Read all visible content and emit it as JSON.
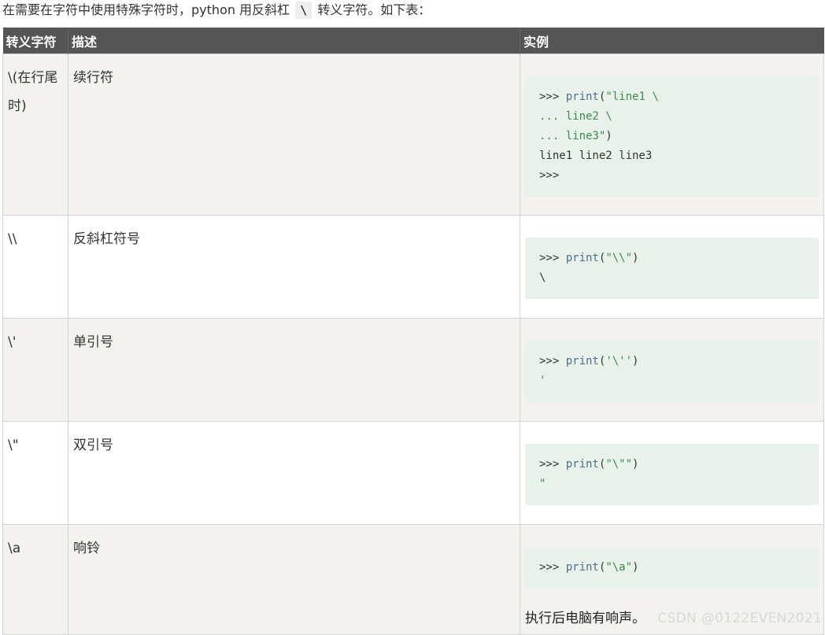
{
  "intro": {
    "text_before": "在需要在字符中使用特殊字符时，python 用反斜杠",
    "code": "\\",
    "text_after": "转义字符。如下表："
  },
  "table": {
    "headers": [
      "转义字符",
      "描述",
      "实例"
    ],
    "rows": [
      {
        "escape": "\\(在行尾时)",
        "description": "续行符",
        "code_lines": [
          [
            {
              "t": ">>> ",
              "c": "p"
            },
            {
              "t": "print",
              "c": "fn"
            },
            {
              "t": "(",
              "c": "p"
            },
            {
              "t": "\"line1 \\",
              "c": "s"
            }
          ],
          [
            {
              "t": "... ",
              "c": "s"
            },
            {
              "t": "line2 \\",
              "c": "s"
            }
          ],
          [
            {
              "t": "... ",
              "c": "s"
            },
            {
              "t": "line3\"",
              "c": "s"
            },
            {
              "t": ")",
              "c": "p"
            }
          ],
          [
            {
              "t": "line1 line2 line3",
              "c": "p"
            }
          ],
          [
            {
              "t": ">>>",
              "c": "p"
            }
          ]
        ],
        "note": ""
      },
      {
        "escape": "\\\\",
        "description": "反斜杠符号",
        "code_lines": [
          [
            {
              "t": ">>> ",
              "c": "p"
            },
            {
              "t": "print",
              "c": "fn"
            },
            {
              "t": "(",
              "c": "p"
            },
            {
              "t": "\"\\\\\"",
              "c": "s"
            },
            {
              "t": ")",
              "c": "p"
            }
          ],
          [
            {
              "t": "\\",
              "c": "p"
            }
          ]
        ],
        "note": ""
      },
      {
        "escape": "\\'",
        "description": "单引号",
        "code_lines": [
          [
            {
              "t": ">>> ",
              "c": "p"
            },
            {
              "t": "print",
              "c": "fn"
            },
            {
              "t": "(",
              "c": "p"
            },
            {
              "t": "'\\''",
              "c": "s"
            },
            {
              "t": ")",
              "c": "p"
            }
          ],
          [
            {
              "t": "'",
              "c": "s"
            }
          ]
        ],
        "note": ""
      },
      {
        "escape": "\\\"",
        "description": "双引号",
        "code_lines": [
          [
            {
              "t": ">>> ",
              "c": "p"
            },
            {
              "t": "print",
              "c": "fn"
            },
            {
              "t": "(",
              "c": "p"
            },
            {
              "t": "\"\\\"\"",
              "c": "s"
            },
            {
              "t": ")",
              "c": "p"
            }
          ],
          [
            {
              "t": "\"",
              "c": "s"
            }
          ]
        ],
        "note": ""
      },
      {
        "escape": "\\a",
        "description": "响铃",
        "code_lines": [
          [
            {
              "t": ">>> ",
              "c": "p"
            },
            {
              "t": "print",
              "c": "fn"
            },
            {
              "t": "(",
              "c": "p"
            },
            {
              "t": "\"\\a\"",
              "c": "s"
            },
            {
              "t": ")",
              "c": "p"
            }
          ]
        ],
        "note": "执行后电脑有响声。"
      }
    ]
  },
  "watermark": "CSDN @0122EVEN2021",
  "colors": {
    "header_bg": "#555555",
    "shaded_row_bg": "#f3f2ef",
    "code_bg": "#e8f2ea",
    "code_string": "#3d8a4e",
    "code_function": "#4e6e8e"
  }
}
